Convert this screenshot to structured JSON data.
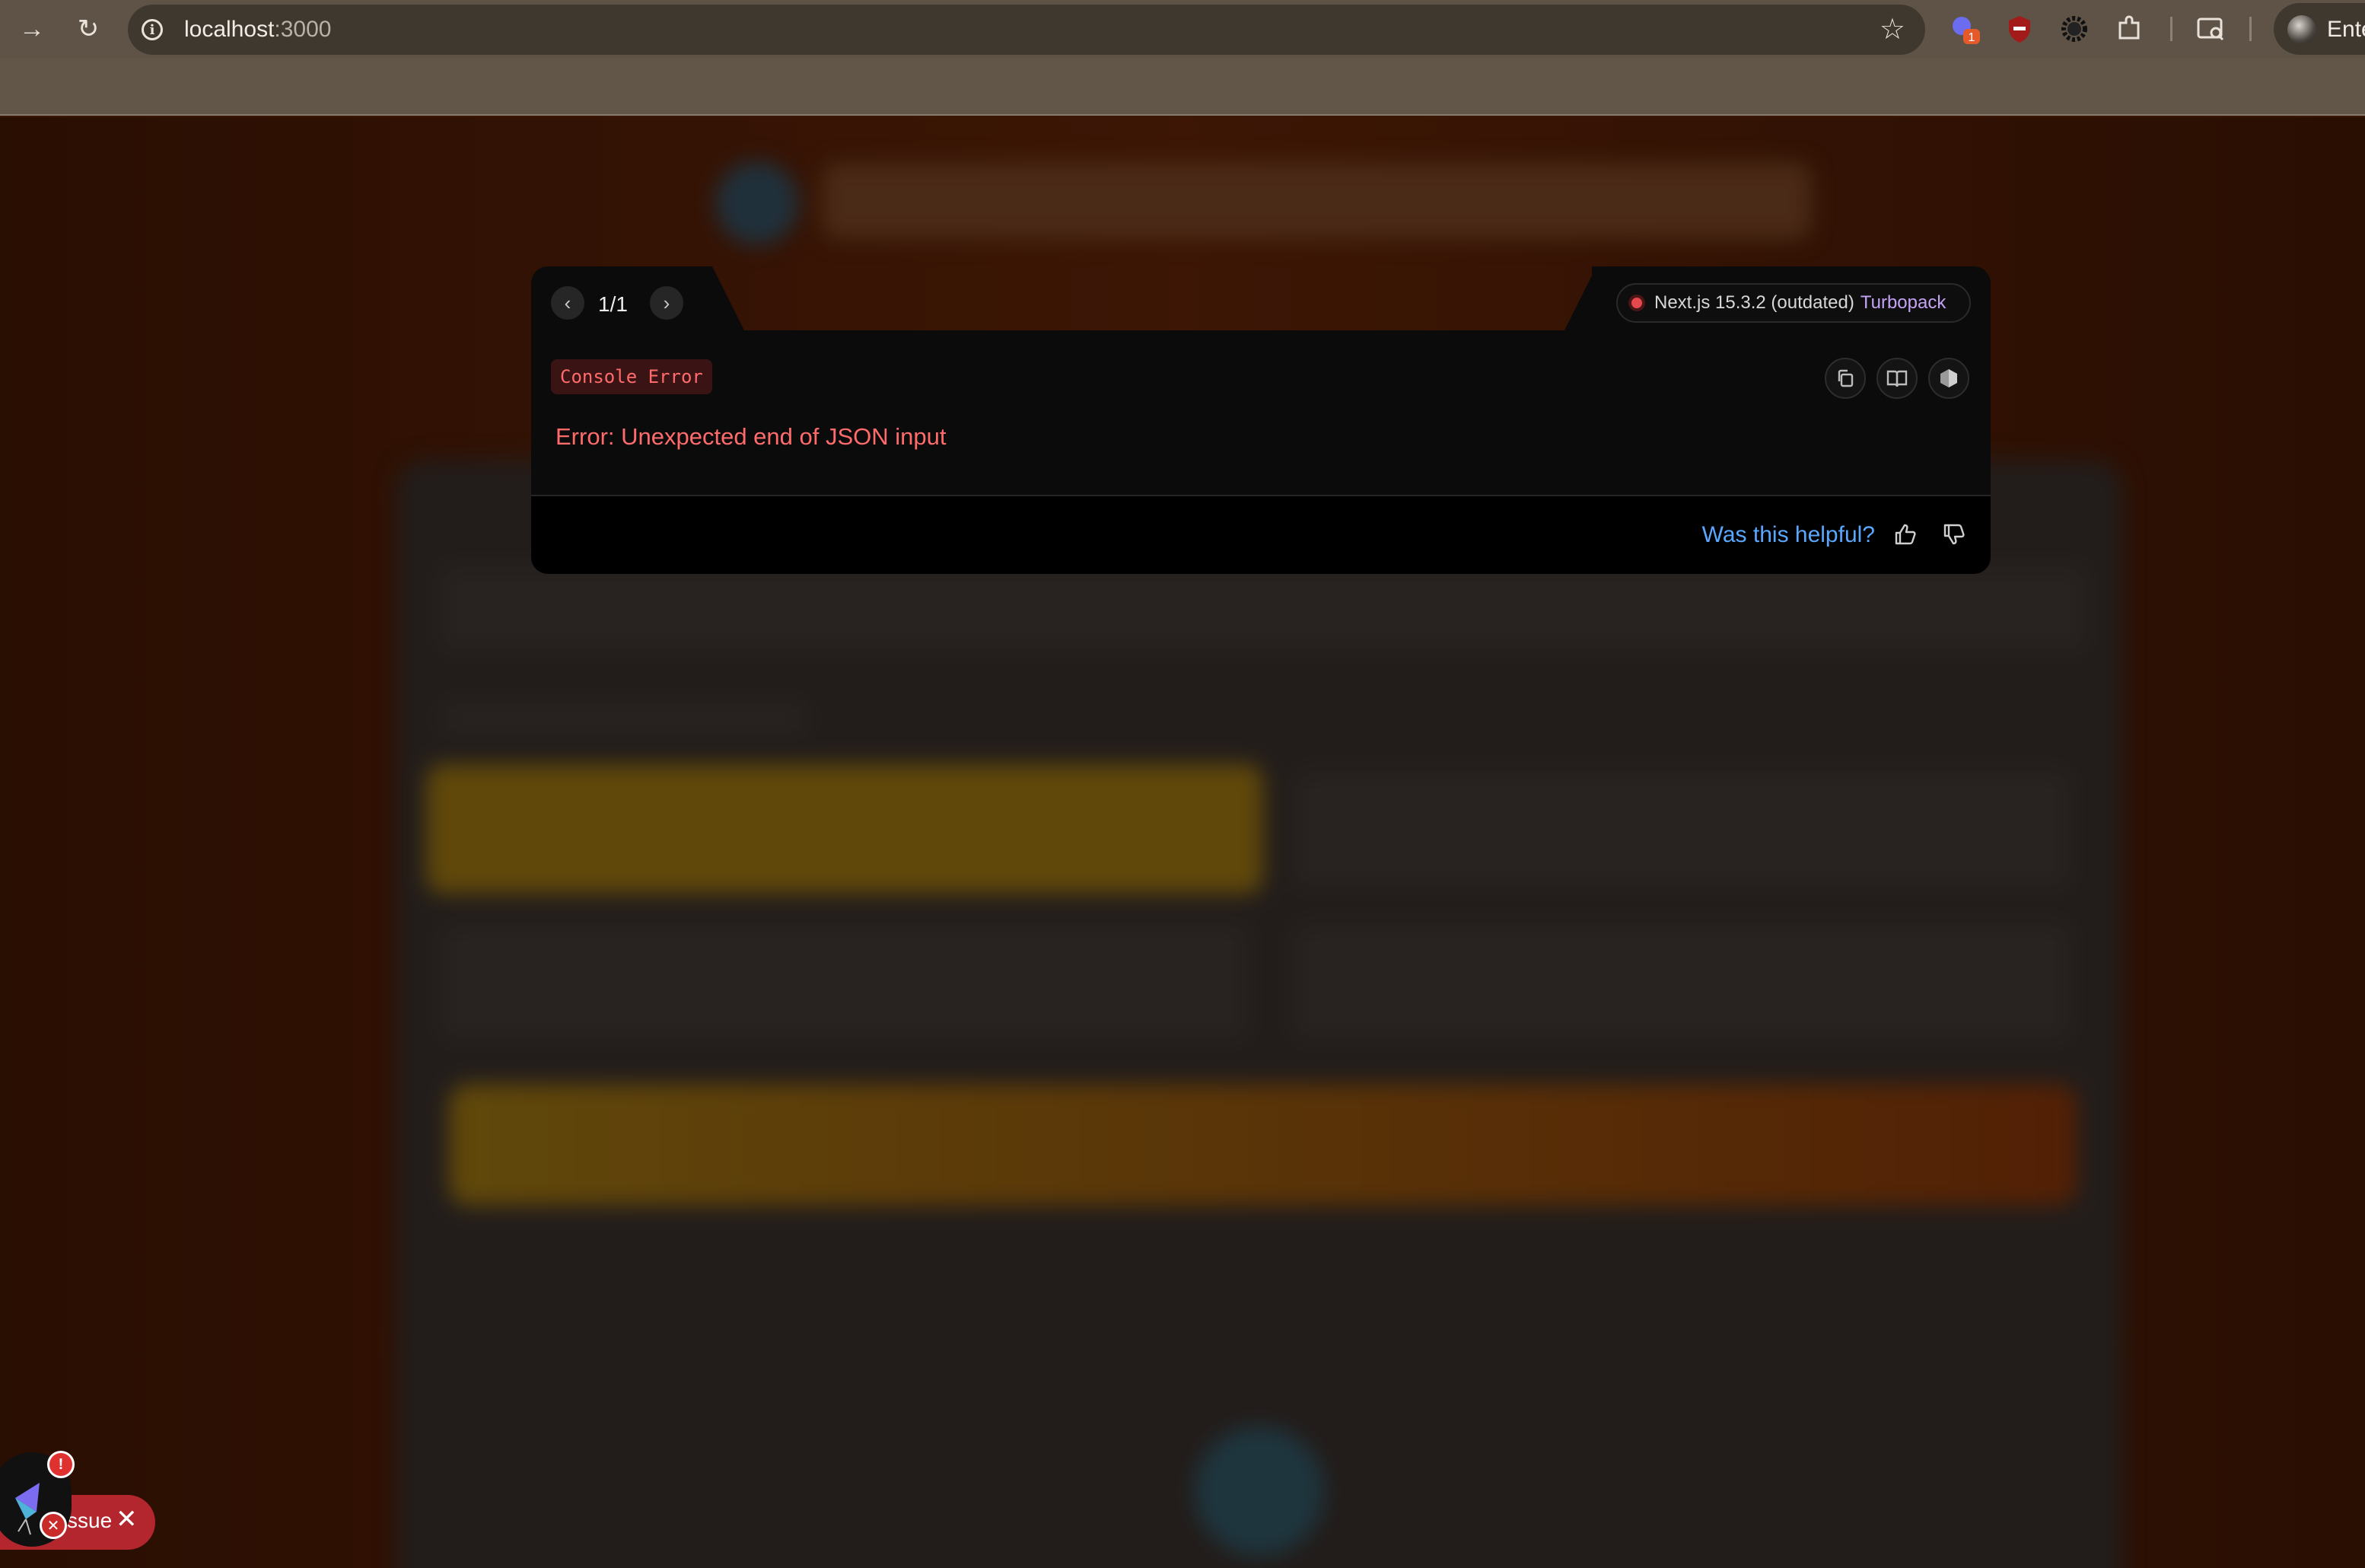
{
  "browser": {
    "url_host": "localhost",
    "url_port": ":3000",
    "profile_label": "Ente",
    "extension_badge": "1"
  },
  "error_overlay": {
    "pager": "1/1",
    "framework_version": "Next.js 15.3.2 (outdated)",
    "bundler": "Turbopack",
    "badge": "Console Error",
    "message": "Error: Unexpected end of JSON input",
    "feedback_prompt": "Was this helpful?",
    "status_color": "#e5484d"
  },
  "issue_indicator": {
    "label": "ssue",
    "badge": "!"
  }
}
